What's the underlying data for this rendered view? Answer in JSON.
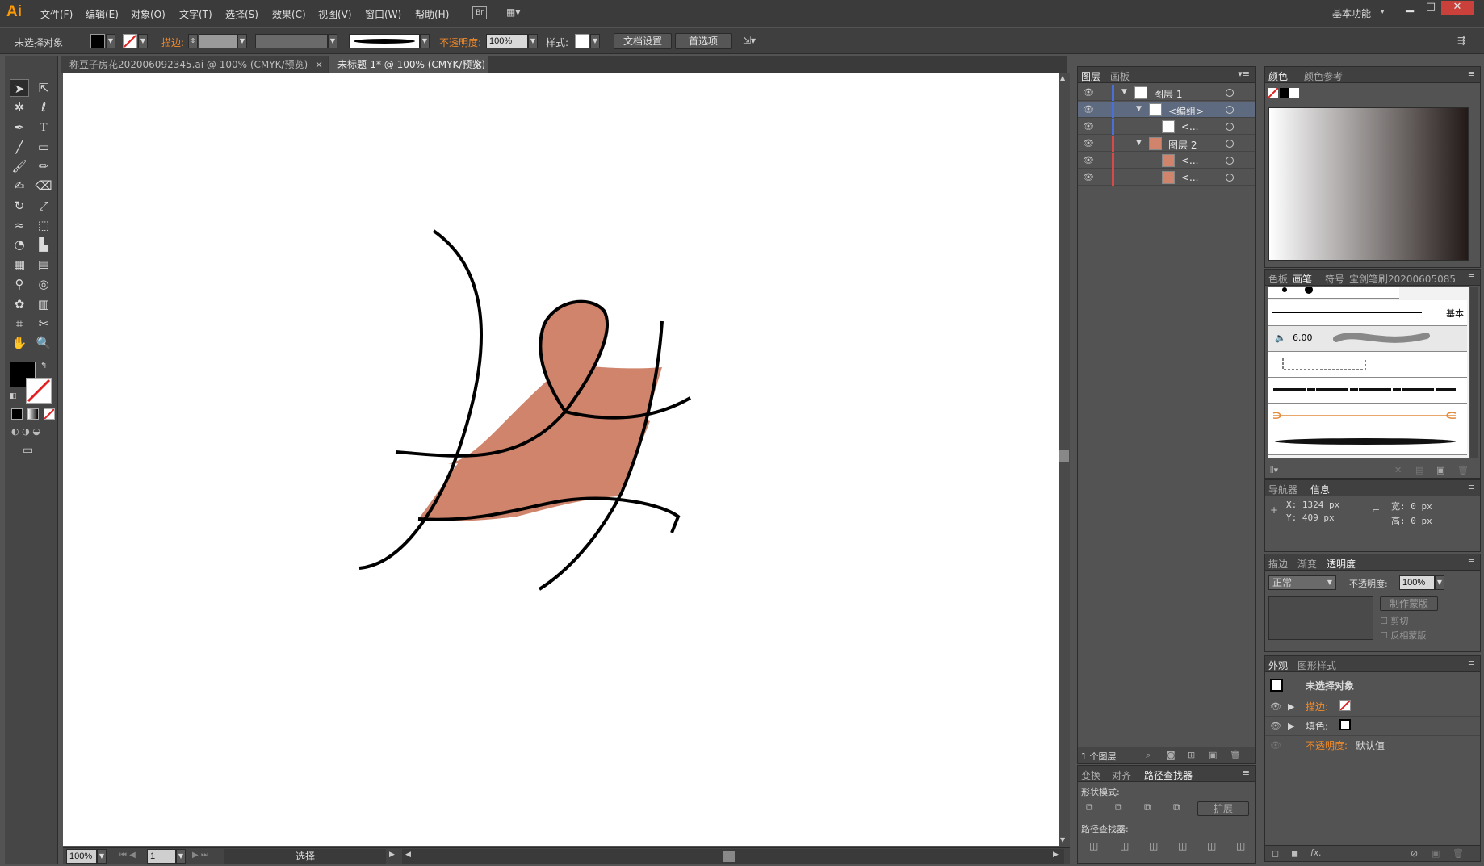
{
  "app": {
    "logo": "Ai",
    "workspace": "基本功能"
  },
  "menu": [
    "文件(F)",
    "编辑(E)",
    "对象(O)",
    "文字(T)",
    "选择(S)",
    "效果(C)",
    "视图(V)",
    "窗口(W)",
    "帮助(H)"
  ],
  "control": {
    "selection": "未选择对象",
    "stroke_label": "描边:",
    "opacity_label": "不透明度:",
    "opacity_value": "100%",
    "style_label": "样式:",
    "doc_setup": "文档设置",
    "preferences": "首选项"
  },
  "tabs": [
    {
      "label": "称豆子房花202006092345.ai @ 100% (CMYK/预览)",
      "active": false
    },
    {
      "label": "未标题-1* @ 100% (CMYK/预览)",
      "active": true
    }
  ],
  "status": {
    "zoom": "100%",
    "page": "1",
    "tool": "选择"
  },
  "layers_panel": {
    "tabs": [
      "图层",
      "画板"
    ],
    "rows": [
      {
        "name": "图层 1",
        "color": "#4a6fd6"
      },
      {
        "name": "<编组>",
        "color": "#4a6fd6"
      },
      {
        "name": "<...",
        "color": "#4a6fd6"
      },
      {
        "name": "图层 2",
        "color": "#d64a4a"
      },
      {
        "name": "<...",
        "color": "#d64a4a"
      },
      {
        "name": "<...",
        "color": "#d64a4a"
      }
    ],
    "footer": "1 个图层"
  },
  "color_panel": {
    "tabs": [
      "颜色",
      "颜色参考"
    ]
  },
  "brushes_panel": {
    "tabs": [
      "色板",
      "画笔",
      "符号",
      "宝剑笔刷20200605085"
    ],
    "basic_label": "基本",
    "size_label": "6.00"
  },
  "info_panel": {
    "tabs": [
      "导航器",
      "信息"
    ],
    "x": "X: 1324 px",
    "y": "Y: 409 px",
    "w": "宽: 0 px",
    "h": "高: 0 px"
  },
  "transparency_panel": {
    "tabs": [
      "描边",
      "渐变",
      "透明度"
    ],
    "mode": "正常",
    "opacity_label": "不透明度:",
    "opacity_value": "100%",
    "make_mask": "制作蒙版",
    "clip": "剪切",
    "invert": "反相蒙版"
  },
  "appearance_panel": {
    "tabs": [
      "外观",
      "图形样式"
    ],
    "title": "未选择对象",
    "stroke": "描边:",
    "fill": "填色:",
    "opacity": "不透明度:",
    "opacity_value": "默认值"
  },
  "pathfinder_panel": {
    "tabs": [
      "变换",
      "对齐",
      "路径查找器"
    ],
    "shape_modes": "形状模式:",
    "expand": "扩展",
    "pathfinders": "路径查找器:"
  },
  "colors": {
    "accent": "#f08a2b",
    "fill_shape": "#cf846b"
  }
}
